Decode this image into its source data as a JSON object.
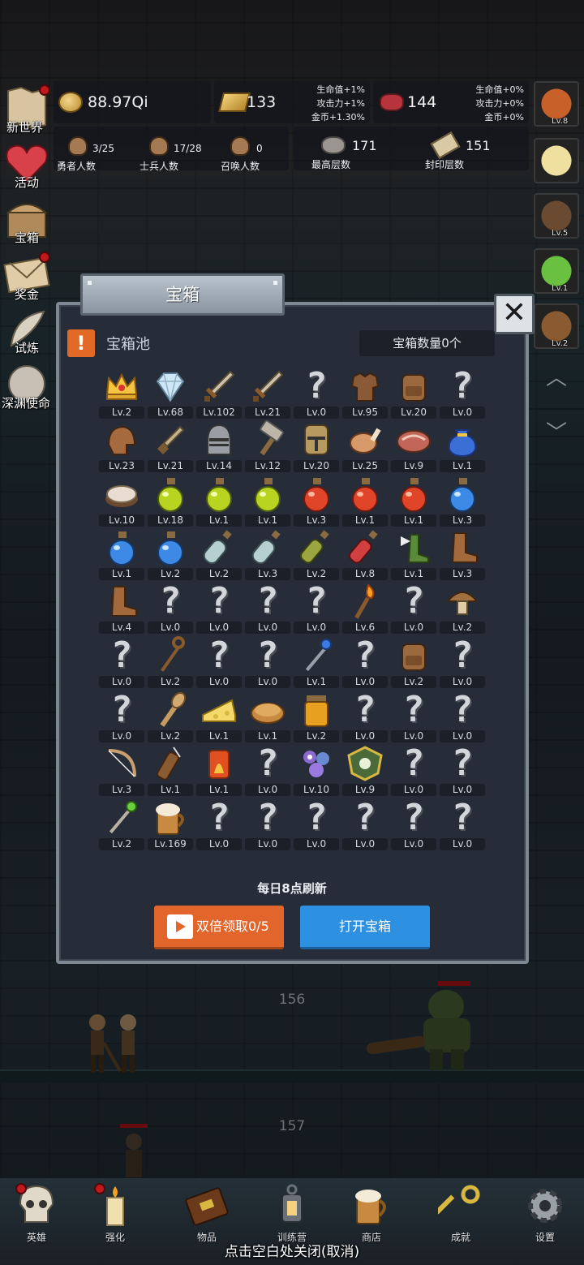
{
  "top_stats": {
    "gold": "88.97Qi",
    "bars": "133",
    "bars_bonus": [
      "生命值+1%",
      "攻击力+1%",
      "金币+1.30%"
    ],
    "meat": "144",
    "meat_bonus": [
      "生命值+0%",
      "攻击力+0%",
      "金币+0%"
    ],
    "heroes_count": "3/25",
    "heroes_label": "勇者人数",
    "soldiers_count": "17/28",
    "soldiers_label": "士兵人数",
    "summon_count": "0",
    "summon_label": "召唤人数",
    "max_floor": "171",
    "max_floor_label": "最高层数",
    "seal_floor": "151",
    "seal_floor_label": "封印层数"
  },
  "left_menu": [
    {
      "label": "新世界",
      "icon": "map-icon",
      "badge": true
    },
    {
      "label": "活动",
      "icon": "heart-icon",
      "badge": false
    },
    {
      "label": "宝箱",
      "icon": "chest-icon",
      "badge": false
    },
    {
      "label": "奖金",
      "icon": "envelope-icon",
      "badge": true
    },
    {
      "label": "试炼",
      "icon": "feather-icon",
      "badge": false
    },
    {
      "label": "深渊使命",
      "icon": "orb-icon",
      "badge": false
    }
  ],
  "right_menu": [
    {
      "icon": "onion-icon",
      "lv": "Lv.8"
    },
    {
      "icon": "candle-icon",
      "lv": ""
    },
    {
      "icon": "box-icon",
      "lv": "Lv.5"
    },
    {
      "icon": "slime-icon",
      "lv": "Lv.1"
    },
    {
      "icon": "monkey-icon",
      "lv": "Lv.2"
    }
  ],
  "floors": {
    "upper": "156",
    "lower": "157"
  },
  "modal": {
    "title": "宝箱",
    "pool_title": "宝箱池",
    "chest_count": "宝箱数量0个",
    "refresh_text": "每日8点刷新",
    "double_button": "双倍领取0/5",
    "open_button": "打开宝箱",
    "items": [
      {
        "icon": "crown",
        "lv": "Lv.2"
      },
      {
        "icon": "diamond",
        "lv": "Lv.68"
      },
      {
        "icon": "sword",
        "lv": "Lv.102"
      },
      {
        "icon": "sword",
        "lv": "Lv.21"
      },
      {
        "icon": "unknown",
        "lv": "Lv.0"
      },
      {
        "icon": "armor",
        "lv": "Lv.95"
      },
      {
        "icon": "backpack",
        "lv": "Lv.20"
      },
      {
        "icon": "unknown",
        "lv": "Lv.0"
      },
      {
        "icon": "helmet",
        "lv": "Lv.23"
      },
      {
        "icon": "dagger",
        "lv": "Lv.21"
      },
      {
        "icon": "knight-helmet",
        "lv": "Lv.14"
      },
      {
        "icon": "hammer",
        "lv": "Lv.12"
      },
      {
        "icon": "great-helm",
        "lv": "Lv.20"
      },
      {
        "icon": "ham",
        "lv": "Lv.25"
      },
      {
        "icon": "steak",
        "lv": "Lv.9"
      },
      {
        "icon": "pouch",
        "lv": "Lv.1"
      },
      {
        "icon": "flour",
        "lv": "Lv.10"
      },
      {
        "icon": "potion-yellow",
        "lv": "Lv.18"
      },
      {
        "icon": "potion-yellow",
        "lv": "Lv.1"
      },
      {
        "icon": "potion-yellow",
        "lv": "Lv.1"
      },
      {
        "icon": "potion-red",
        "lv": "Lv.3"
      },
      {
        "icon": "potion-red",
        "lv": "Lv.1"
      },
      {
        "icon": "potion-red",
        "lv": "Lv.1"
      },
      {
        "icon": "potion-blue",
        "lv": "Lv.3"
      },
      {
        "icon": "potion-blue",
        "lv": "Lv.1"
      },
      {
        "icon": "potion-blue",
        "lv": "Lv.2"
      },
      {
        "icon": "bottle-clear",
        "lv": "Lv.2"
      },
      {
        "icon": "bottle-clear",
        "lv": "Lv.3"
      },
      {
        "icon": "bottle-green",
        "lv": "Lv.2"
      },
      {
        "icon": "bottle-red",
        "lv": "Lv.8"
      },
      {
        "icon": "winged-boot",
        "lv": "Lv.1"
      },
      {
        "icon": "boot",
        "lv": "Lv.3"
      },
      {
        "icon": "boot",
        "lv": "Lv.4"
      },
      {
        "icon": "unknown",
        "lv": "Lv.0"
      },
      {
        "icon": "unknown",
        "lv": "Lv.0"
      },
      {
        "icon": "unknown",
        "lv": "Lv.0"
      },
      {
        "icon": "unknown",
        "lv": "Lv.0"
      },
      {
        "icon": "torch",
        "lv": "Lv.6"
      },
      {
        "icon": "unknown",
        "lv": "Lv.0"
      },
      {
        "icon": "mushroom",
        "lv": "Lv.2"
      },
      {
        "icon": "unknown",
        "lv": "Lv.0"
      },
      {
        "icon": "staff",
        "lv": "Lv.2"
      },
      {
        "icon": "unknown",
        "lv": "Lv.0"
      },
      {
        "icon": "unknown",
        "lv": "Lv.0"
      },
      {
        "icon": "wand",
        "lv": "Lv.1"
      },
      {
        "icon": "unknown",
        "lv": "Lv.0"
      },
      {
        "icon": "backpack",
        "lv": "Lv.2"
      },
      {
        "icon": "unknown",
        "lv": "Lv.0"
      },
      {
        "icon": "unknown",
        "lv": "Lv.0"
      },
      {
        "icon": "club",
        "lv": "Lv.2"
      },
      {
        "icon": "cheese",
        "lv": "Lv.1"
      },
      {
        "icon": "pie",
        "lv": "Lv.1"
      },
      {
        "icon": "jar",
        "lv": "Lv.2"
      },
      {
        "icon": "unknown",
        "lv": "Lv.0"
      },
      {
        "icon": "unknown",
        "lv": "Lv.0"
      },
      {
        "icon": "unknown",
        "lv": "Lv.0"
      },
      {
        "icon": "bow",
        "lv": "Lv.3"
      },
      {
        "icon": "quiver",
        "lv": "Lv.1"
      },
      {
        "icon": "fire-gem",
        "lv": "Lv.1"
      },
      {
        "icon": "unknown",
        "lv": "Lv.0"
      },
      {
        "icon": "tentacle",
        "lv": "Lv.10"
      },
      {
        "icon": "emblem",
        "lv": "Lv.9"
      },
      {
        "icon": "unknown",
        "lv": "Lv.0"
      },
      {
        "icon": "unknown",
        "lv": "Lv.0"
      },
      {
        "icon": "green-wand",
        "lv": "Lv.2"
      },
      {
        "icon": "beer",
        "lv": "Lv.169"
      },
      {
        "icon": "unknown",
        "lv": "Lv.0"
      },
      {
        "icon": "unknown",
        "lv": "Lv.0"
      },
      {
        "icon": "unknown",
        "lv": "Lv.0"
      },
      {
        "icon": "unknown",
        "lv": "Lv.0"
      },
      {
        "icon": "unknown",
        "lv": "Lv.0"
      },
      {
        "icon": "unknown",
        "lv": "Lv.0"
      }
    ]
  },
  "bottom_nav": [
    {
      "label": "英雄",
      "icon": "skull-icon",
      "badge": true
    },
    {
      "label": "强化",
      "icon": "candle-icon",
      "badge": true
    },
    {
      "label": "物品",
      "icon": "book-icon",
      "badge": false
    },
    {
      "label": "训练营",
      "icon": "lantern-icon",
      "badge": false
    },
    {
      "label": "商店",
      "icon": "beer-icon",
      "badge": false
    },
    {
      "label": "成就",
      "icon": "key-icon",
      "badge": false
    },
    {
      "label": "设置",
      "icon": "gear-icon",
      "badge": false
    }
  ],
  "close_hint": "点击空白处关闭(取消)"
}
